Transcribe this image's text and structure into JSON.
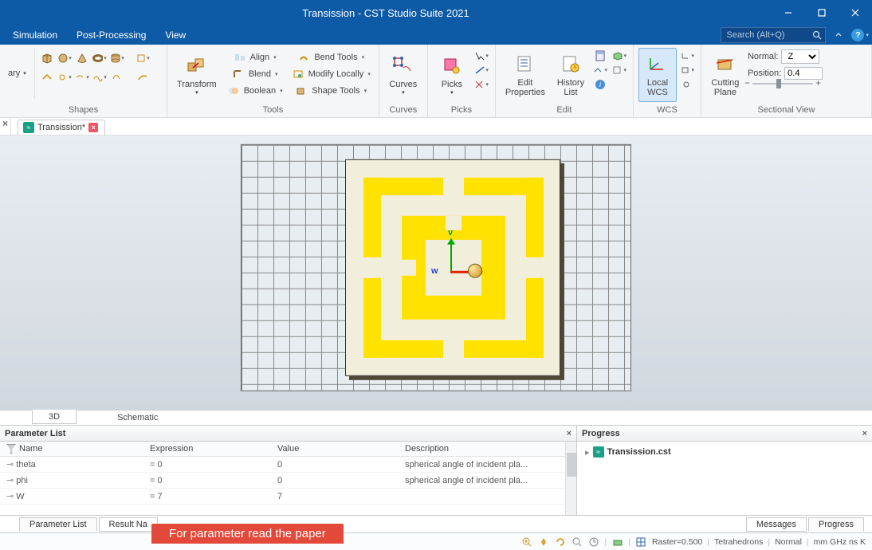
{
  "window": {
    "title": "Transission - CST Studio Suite 2021"
  },
  "menu": {
    "simulation": "Simulation",
    "post": "Post-Processing",
    "view": "View"
  },
  "search": {
    "placeholder": "Search (Alt+Q)"
  },
  "ribbon": {
    "shapes_half": "ary",
    "shapes": "Shapes",
    "transform": "Transform",
    "align": "Align",
    "blend": "Blend",
    "boolean": "Boolean",
    "bend": "Bend Tools",
    "modify": "Modify Locally",
    "shapetools": "Shape Tools",
    "tools": "Tools",
    "curves_btn": "Curves",
    "curves": "Curves",
    "picks_btn": "Picks",
    "picks": "Picks",
    "editprops": "Edit\nProperties",
    "history": "History\nList",
    "edit": "Edit",
    "localwcs": "Local\nWCS",
    "wcs": "WCS",
    "cutting": "Cutting\nPlane",
    "normal": "Normal:",
    "normal_val": "Z",
    "position": "Position:",
    "position_val": "0.4",
    "sectional": "Sectional View"
  },
  "doc_tab": {
    "name": "Transission*"
  },
  "axes": {
    "v": "v",
    "w": "w"
  },
  "lower_tabs": {
    "three_d": "3D",
    "schematic": "Schematic"
  },
  "paramlist": {
    "title": "Parameter List",
    "cols": {
      "name": "Name",
      "expr": "Expression",
      "value": "Value",
      "desc": "Description"
    },
    "rows": [
      {
        "name": "theta",
        "expr": "= 0",
        "value": "0",
        "desc": "spherical angle of incident pla..."
      },
      {
        "name": "phi",
        "expr": "= 0",
        "value": "0",
        "desc": "spherical angle of incident pla..."
      },
      {
        "name": "W",
        "expr": "= 7",
        "value": "7",
        "desc": ""
      }
    ]
  },
  "progress": {
    "title": "Progress",
    "file": "Transission.cst"
  },
  "bottom_tabs": {
    "paramlist": "Parameter List",
    "resultnav": "Result Na",
    "messages": "Messages",
    "progress": "Progress"
  },
  "banner": "For parameter read the paper",
  "status": {
    "raster": "Raster=0.500",
    "tet": "Tetrahedrons",
    "normal": "Normal",
    "units": "mm  GHz  ns  K"
  }
}
